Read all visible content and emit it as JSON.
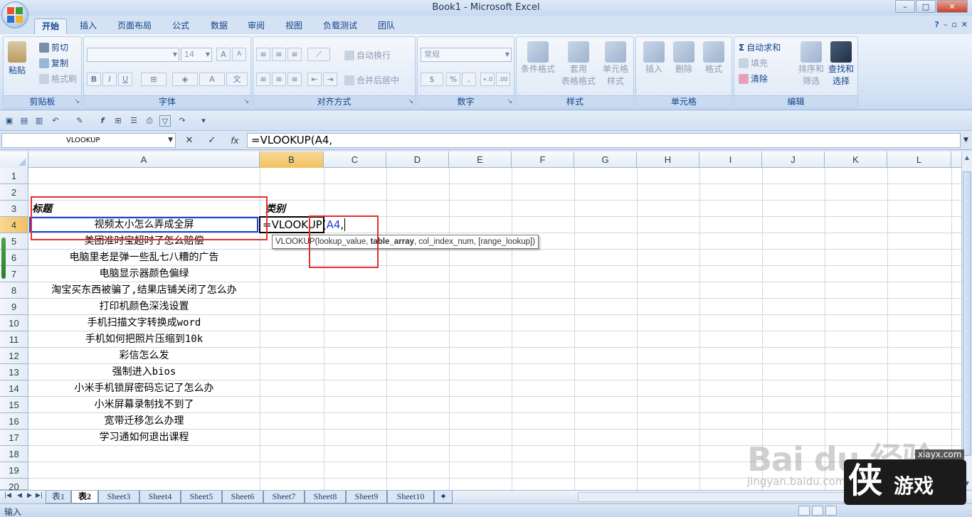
{
  "window": {
    "title": "Book1 - Microsoft Excel",
    "min": "–",
    "max": "□",
    "close": "✕"
  },
  "ribbon_tabs": [
    "开始",
    "插入",
    "页面布局",
    "公式",
    "数据",
    "审阅",
    "视图",
    "负载测试",
    "团队"
  ],
  "ribbon": {
    "clipboard": {
      "label": "剪贴板",
      "paste": "粘贴",
      "cut": "剪切",
      "copy": "复制",
      "format_painter": "格式刷"
    },
    "font": {
      "label": "字体",
      "font_size": "14",
      "bold": "B",
      "italic": "I",
      "underline": "U",
      "grow": "A",
      "shrink": "A"
    },
    "alignment": {
      "label": "对齐方式",
      "wrap_text": "自动换行",
      "merge_center": "合并后居中"
    },
    "number": {
      "label": "数字",
      "format": "常规",
      "percent": "%",
      "comma": ",",
      "inc_decimal": "+.0",
      "dec_decimal": ".00"
    },
    "styles": {
      "label": "样式",
      "conditional": "条件格式",
      "table_line1": "套用",
      "table_line2": "表格格式",
      "cell_line1": "单元格",
      "cell_line2": "样式"
    },
    "cells": {
      "label": "单元格",
      "insert": "插入",
      "delete": "删除",
      "format": "格式"
    },
    "editing": {
      "label": "编辑",
      "autosum": "自动求和",
      "fill": "填充",
      "clear": "清除",
      "sort_line1": "排序和",
      "sort_line2": "筛选",
      "find_line1": "查找和",
      "find_line2": "选择"
    }
  },
  "formula_bar": {
    "name_box": "VLOOKUP",
    "cancel": "✕",
    "enter": "✓",
    "fx": "fx",
    "formula": "=VLOOKUP(A4,"
  },
  "columns": [
    "A",
    "B",
    "C",
    "D",
    "E",
    "F",
    "G",
    "H",
    "I",
    "J",
    "K",
    "L"
  ],
  "selected_column": "B",
  "rows": [
    "1",
    "2",
    "3",
    "4",
    "5",
    "6",
    "7",
    "8",
    "9",
    "10",
    "11",
    "12",
    "13",
    "14",
    "15",
    "16",
    "17",
    "18",
    "19",
    "20"
  ],
  "selected_row": "4",
  "cells": {
    "A3": "标题",
    "B3": "类别",
    "A4": "视频太小怎么弄成全屏",
    "A5": "美团准时宝超时了怎么赔偿",
    "A6": "电脑里老是弹一些乱七八糟的广告",
    "A7": "电脑显示器颜色偏绿",
    "A8": "淘宝买东西被骗了,结果店铺关闭了怎么办",
    "A9": "打印机颜色深浅设置",
    "A10": "手机扫描文字转换成word",
    "A11": "手机如何把照片压缩到10k",
    "A12": "彩信怎么发",
    "A13": "强制进入bios",
    "A14": "小米手机锁屏密码忘记了怎么办",
    "A15": "小米屏幕录制找不到了",
    "A16": "宽带迁移怎么办理",
    "A17": "学习通如何退出课程"
  },
  "active_cell": {
    "prefix": "=VLOOKUP(",
    "ref": "A4",
    "suffix": ","
  },
  "tooltip": {
    "fn": "VLOOKUP(",
    "arg1": "lookup_value, ",
    "arg2": "table_array",
    "rest": ", col_index_num, [range_lookup])"
  },
  "sheets": [
    "表1",
    "表2",
    "Sheet3",
    "Sheet4",
    "Sheet5",
    "Sheet6",
    "Sheet7",
    "Sheet8",
    "Sheet9",
    "Sheet10"
  ],
  "active_sheet": "表2",
  "status": {
    "mode": "输入"
  },
  "watermark": {
    "baidu": "Bai du 经验",
    "url": "jingyan.baidu.com",
    "logo_glyph": "侠",
    "logo_text": "游戏",
    "site": "xiayx.com"
  },
  "colors": {
    "accent": "#15428b",
    "selected_header": "#f1c15f",
    "annotation_red": "#e52d2d",
    "range_blue": "#1f3fd6"
  }
}
